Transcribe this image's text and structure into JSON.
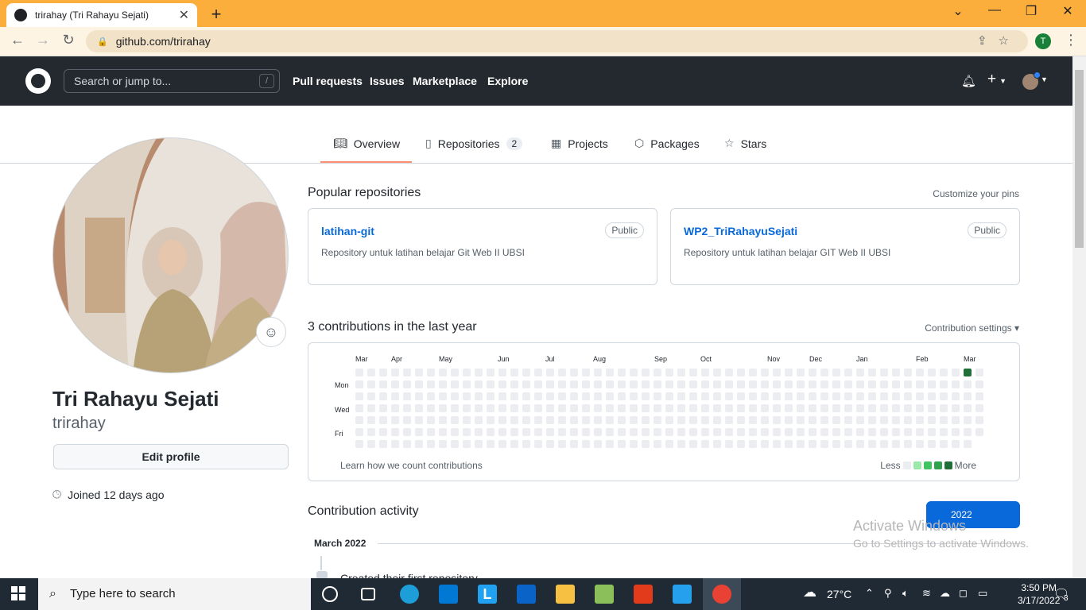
{
  "browser": {
    "tab_title": "trirahay (Tri Rahayu Sejati)",
    "url": "github.com/trirahay",
    "profile_initial": "T"
  },
  "github_header": {
    "search_placeholder": "Search or jump to...",
    "search_shortcut": "/",
    "nav": [
      "Pull requests",
      "Issues",
      "Marketplace",
      "Explore"
    ]
  },
  "profile_tabs": [
    {
      "label": "Overview",
      "icon": "book-icon"
    },
    {
      "label": "Repositories",
      "icon": "repo-icon",
      "count": "2"
    },
    {
      "label": "Projects",
      "icon": "table-icon"
    },
    {
      "label": "Packages",
      "icon": "package-icon"
    },
    {
      "label": "Stars",
      "icon": "star-icon"
    }
  ],
  "profile": {
    "name": "Tri Rahayu Sejati",
    "login": "trirahay",
    "edit_label": "Edit profile",
    "joined": "Joined 12 days ago"
  },
  "popular": {
    "title": "Popular repositories",
    "customize": "Customize your pins",
    "repos": [
      {
        "name": "latihan-git",
        "visibility": "Public",
        "description": "Repository untuk latihan belajar Git Web II UBSI"
      },
      {
        "name": "WP2_TriRahayuSejati",
        "visibility": "Public",
        "description": "Repository untuk latihan belajar GIT Web II UBSI"
      }
    ]
  },
  "contributions": {
    "title": "3 contributions in the last year",
    "settings": "Contribution settings",
    "months": [
      "Mar",
      "Apr",
      "May",
      "Jun",
      "Jul",
      "Aug",
      "Sep",
      "Oct",
      "Nov",
      "Dec",
      "Jan",
      "Feb",
      "Mar"
    ],
    "days": [
      "Mon",
      "Wed",
      "Fri"
    ],
    "learn": "Learn how we count contributions",
    "legend_less": "Less",
    "legend_more": "More",
    "colors": [
      "#ebedf0",
      "#9be9a8",
      "#40c463",
      "#30a14e",
      "#216e39"
    ]
  },
  "activity": {
    "title": "Contribution activity",
    "year": "2022",
    "month": "March 2022",
    "first_item": "Created their first repository"
  },
  "watermark": {
    "line1": "Activate Windows",
    "line2": "Go to Settings to activate Windows."
  },
  "taskbar": {
    "search": "Type here to search",
    "temp": "27°C",
    "time": "3:50 PM",
    "date": "3/17/2022",
    "notif_count": "3"
  }
}
